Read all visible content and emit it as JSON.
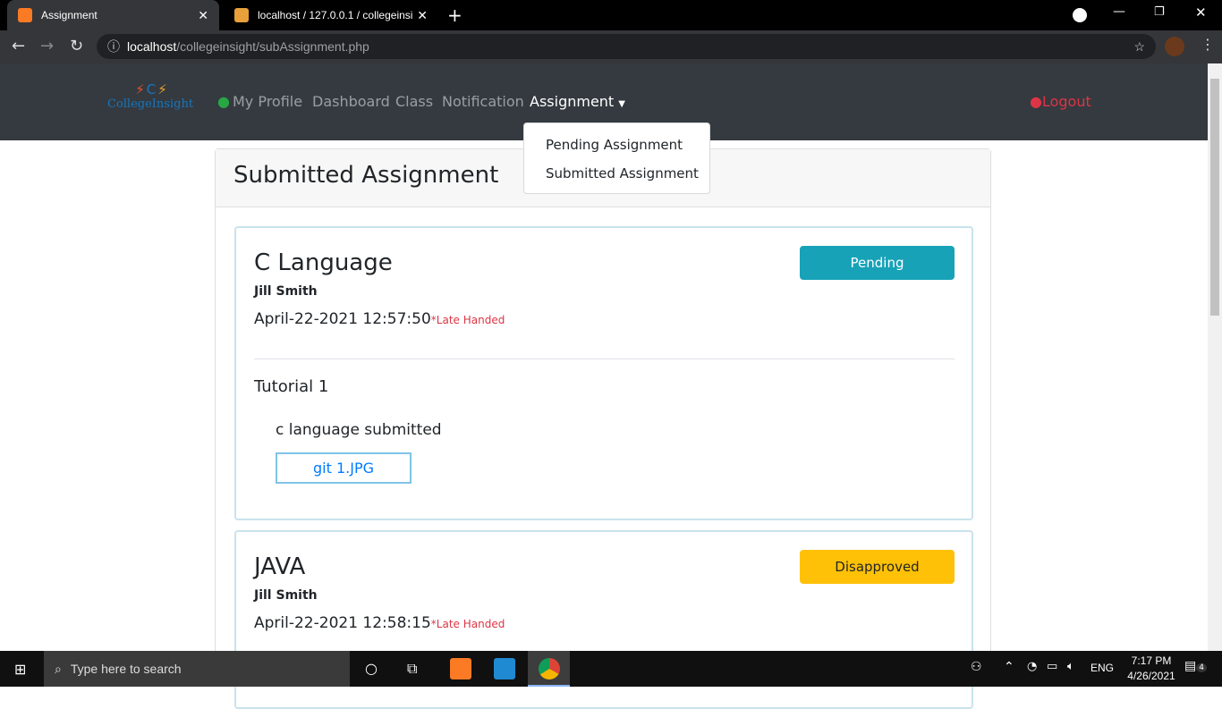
{
  "browser": {
    "tabs": [
      {
        "title": "Assignment"
      },
      {
        "title": "localhost / 127.0.0.1 / collegeinsi"
      }
    ],
    "url_host": "localhost",
    "url_path": "/collegeinsight/subAssignment.php"
  },
  "nav": {
    "brand": "CollegeInsight",
    "brand_letter": "C",
    "items": [
      "My Profile",
      "Dashboard",
      "Class",
      "Notification",
      "Assignment"
    ],
    "logout": "Logout"
  },
  "dropdown": [
    "Pending Assignment",
    "Submitted Assignment"
  ],
  "page": {
    "title": "Submitted Assignment"
  },
  "submissions": [
    {
      "subject": "C Language",
      "student": "Jill Smith",
      "datetime": "April-22-2021 12:57:50",
      "late": "*Late Handed",
      "status": "Pending",
      "status_color": "#17a2b8",
      "assignment": "Tutorial 1",
      "note": "c language submitted",
      "file": "git 1.JPG"
    },
    {
      "subject": "JAVA",
      "student": "Jill Smith",
      "datetime": "April-22-2021 12:58:15",
      "late": "*Late Handed",
      "status": "Disapproved",
      "status_color": "#ffc107"
    }
  ],
  "taskbar": {
    "search": "Type here to search",
    "lang": "ENG",
    "time": "7:17 PM",
    "date": "4/26/2021",
    "notifications": "4"
  }
}
